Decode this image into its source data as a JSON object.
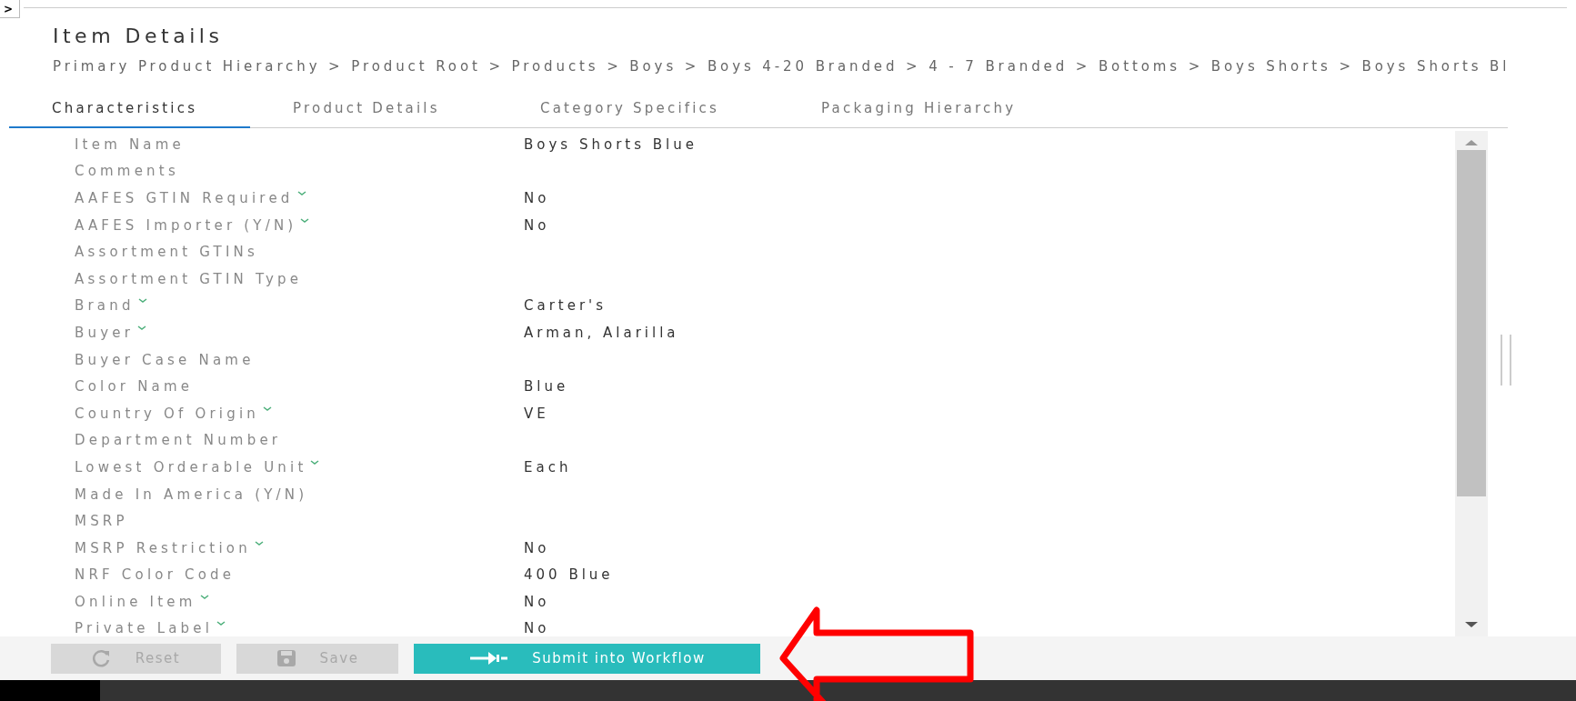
{
  "toggle": {
    "label": ">"
  },
  "title": "Item Details",
  "breadcrumb": "Primary Product Hierarchy > Product Root > Products > Boys > Boys 4-20 Branded > 4 - 7 Branded > Bottoms > Boys Shorts > Boys Shorts Bl",
  "tabs": [
    {
      "label": "Characteristics",
      "selected": true
    },
    {
      "label": "Product Details",
      "selected": false
    },
    {
      "label": "Category Specifics",
      "selected": false
    },
    {
      "label": "Packaging Hierarchy",
      "selected": false
    }
  ],
  "attributes": [
    {
      "label": "Item Name",
      "dropdown": false,
      "value": "Boys Shorts Blue"
    },
    {
      "label": "Comments",
      "dropdown": false
    },
    {
      "label": "AAFES GTIN Required",
      "dropdown": true,
      "value": "No"
    },
    {
      "label": "AAFES Importer (Y/N)",
      "dropdown": true,
      "value": "No"
    },
    {
      "label": "Assortment GTINs",
      "dropdown": false
    },
    {
      "label": "Assortment GTIN Type",
      "dropdown": false
    },
    {
      "label": "Brand",
      "dropdown": true,
      "value": "Carter's"
    },
    {
      "label": "Buyer",
      "dropdown": true,
      "value": "Arman, Alarilla"
    },
    {
      "label": "Buyer Case Name",
      "dropdown": false
    },
    {
      "label": "Color Name",
      "dropdown": false,
      "value": "Blue"
    },
    {
      "label": "Country Of Origin",
      "dropdown": true,
      "value": "VE"
    },
    {
      "label": "Department Number",
      "dropdown": false
    },
    {
      "label": "Lowest Orderable Unit",
      "dropdown": true,
      "value": "Each"
    },
    {
      "label": "Made In America (Y/N)",
      "dropdown": false
    },
    {
      "label": "MSRP",
      "dropdown": false
    },
    {
      "label": "MSRP Restriction",
      "dropdown": true,
      "value": "No"
    },
    {
      "label": "NRF Color Code",
      "dropdown": false,
      "value": "400 Blue"
    },
    {
      "label": "Online Item",
      "dropdown": true,
      "value": "No"
    },
    {
      "label": "Private Label",
      "dropdown": true,
      "value": "No"
    }
  ],
  "buttons": [
    {
      "kind": "reset",
      "label": "Reset",
      "disabled": true
    },
    {
      "kind": "save",
      "label": "Save",
      "disabled": true
    },
    {
      "kind": "submit",
      "label": "Submit into Workflow",
      "disabled": false
    }
  ]
}
